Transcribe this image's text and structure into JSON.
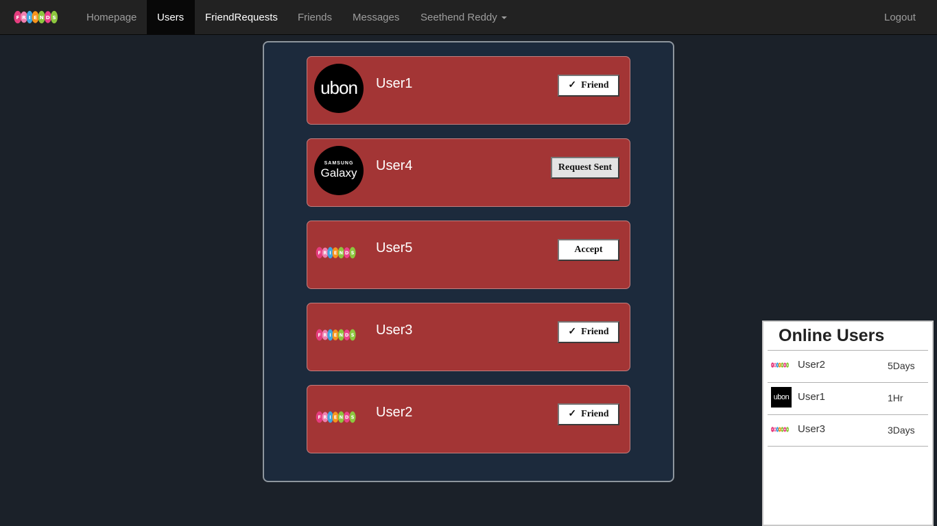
{
  "navbar": {
    "brand_logo_text": "FRIENDS",
    "links": [
      {
        "label": "Homepage"
      },
      {
        "label": "Users"
      },
      {
        "label": "FriendRequests"
      },
      {
        "label": "Friends"
      },
      {
        "label": "Messages"
      },
      {
        "label": "Seethend Reddy"
      }
    ],
    "logout_label": "Logout"
  },
  "users": [
    {
      "name": "User1",
      "avatar": "ubon",
      "action": "Friend",
      "action_icon": "check-icon",
      "avatar_text": "ubon"
    },
    {
      "name": "User4",
      "avatar": "samsung-galaxy",
      "action": "Request Sent",
      "avatar_small": "SAMSUNG",
      "avatar_big": "Galaxy"
    },
    {
      "name": "User5",
      "avatar": "friends-logo",
      "action": "Accept",
      "avatar_text": "FRIENDS"
    },
    {
      "name": "User3",
      "avatar": "friends-logo",
      "action": "Friend",
      "action_icon": "check-icon",
      "avatar_text": "FRIENDS"
    },
    {
      "name": "User2",
      "avatar": "friends-logo",
      "action": "Friend",
      "action_icon": "check-icon",
      "avatar_text": "FRIENDS"
    }
  ],
  "check_glyph": "✓",
  "online_users": {
    "title": "Online Users",
    "rows": [
      {
        "name": "User2",
        "time": "5Days",
        "avatar": "friends-logo"
      },
      {
        "name": "User1",
        "time": "1Hr",
        "avatar": "ubon",
        "avatar_text": "ubon"
      },
      {
        "name": "User3",
        "time": "3Days",
        "avatar": "friends-logo"
      }
    ]
  },
  "colors": {
    "page_bg": "#1b2129",
    "navbar_bg": "#222222",
    "card_bg": "#a33535",
    "panel_bg": "#1c2a3c"
  }
}
